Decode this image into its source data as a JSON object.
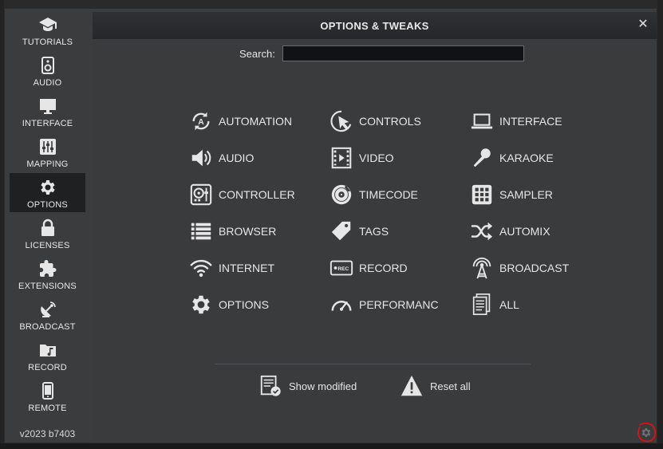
{
  "sidebar": {
    "items": [
      {
        "label": "TUTORIALS",
        "icon": "graduation-cap-icon"
      },
      {
        "label": "AUDIO",
        "icon": "speaker-icon"
      },
      {
        "label": "INTERFACE",
        "icon": "monitor-icon"
      },
      {
        "label": "MAPPING",
        "icon": "sliders-icon"
      },
      {
        "label": "OPTIONS",
        "icon": "gear-icon",
        "active": true
      },
      {
        "label": "LICENSES",
        "icon": "lock-icon"
      },
      {
        "label": "EXTENSIONS",
        "icon": "puzzle-icon"
      },
      {
        "label": "BROADCAST",
        "icon": "satellite-dish-icon"
      },
      {
        "label": "RECORD",
        "icon": "music-folder-icon"
      },
      {
        "label": "REMOTE",
        "icon": "tablet-icon"
      }
    ],
    "version": "v2023 b7403"
  },
  "panel": {
    "title": "OPTIONS & TWEAKS",
    "close": "✕",
    "search": {
      "label": "Search:",
      "value": "",
      "placeholder": ""
    },
    "categories": [
      {
        "label": "AUTOMATION",
        "icon": "automation-icon"
      },
      {
        "label": "CONTROLS",
        "icon": "cursor-click-icon"
      },
      {
        "label": "INTERFACE",
        "icon": "laptop-icon"
      },
      {
        "label": "AUDIO",
        "icon": "speaker-volume-icon"
      },
      {
        "label": "VIDEO",
        "icon": "film-icon"
      },
      {
        "label": "KARAOKE",
        "icon": "microphone-icon"
      },
      {
        "label": "CONTROLLER",
        "icon": "controller-icon"
      },
      {
        "label": "TIMECODE",
        "icon": "vinyl-icon"
      },
      {
        "label": "SAMPLER",
        "icon": "pad-grid-icon"
      },
      {
        "label": "BROWSER",
        "icon": "list-icon"
      },
      {
        "label": "TAGS",
        "icon": "tag-icon"
      },
      {
        "label": "AUTOMIX",
        "icon": "shuffle-icon"
      },
      {
        "label": "INTERNET",
        "icon": "wifi-icon"
      },
      {
        "label": "RECORD",
        "icon": "rec-icon"
      },
      {
        "label": "BROADCAST",
        "icon": "antenna-icon"
      },
      {
        "label": "OPTIONS",
        "icon": "gear-icon"
      },
      {
        "label": "PERFORMANC",
        "icon": "gauge-icon"
      },
      {
        "label": "ALL",
        "icon": "documents-icon"
      }
    ],
    "actions": {
      "show_modified": "Show modified",
      "reset_all": "Reset all"
    }
  },
  "colors": {
    "background": "#3b3c3e",
    "titlebar": "#26272a",
    "active_item": "#1f2022",
    "text": "#e6e6e6",
    "annotation_circle": "#e01010"
  }
}
